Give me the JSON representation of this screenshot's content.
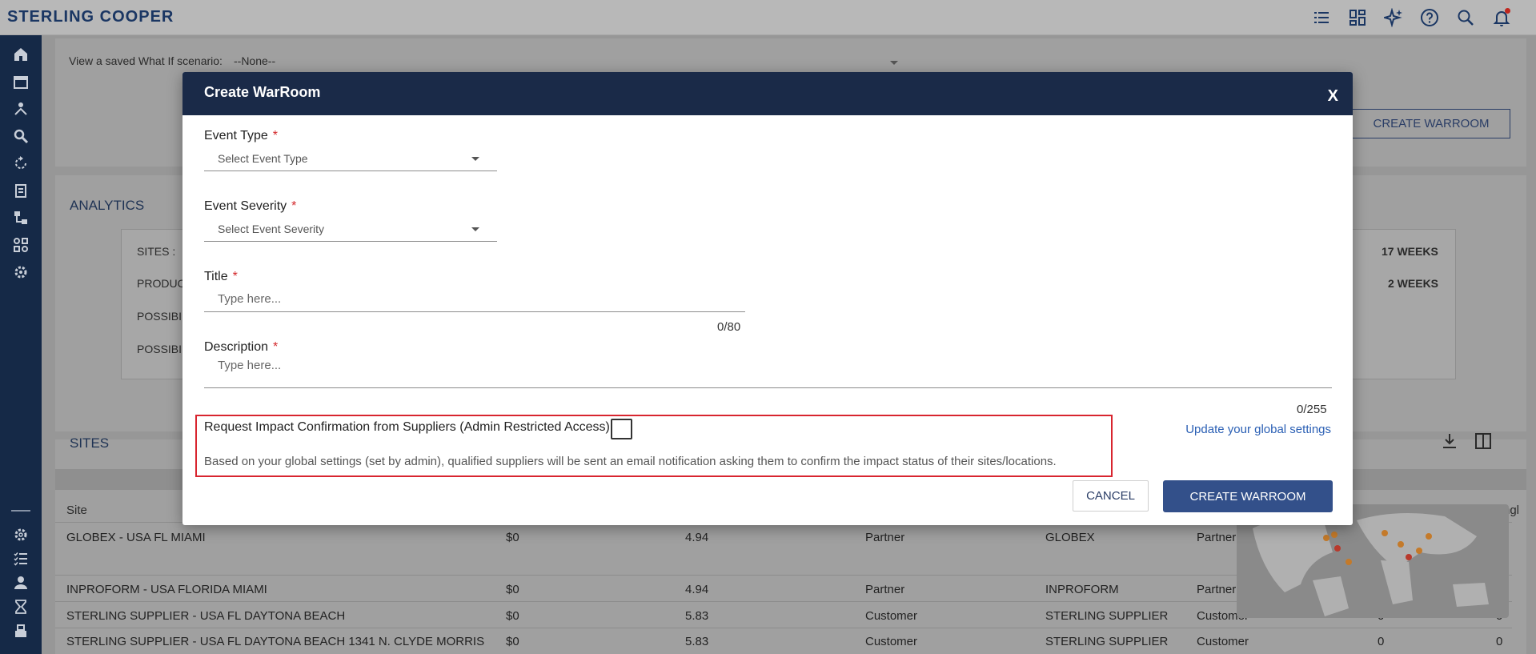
{
  "app": {
    "brand": "STERLING COOPER"
  },
  "topbar": {
    "icons": [
      "list-icon",
      "dashboard-icon",
      "sparkle-icon",
      "help-icon",
      "search-icon",
      "bell-icon"
    ]
  },
  "sidebar": {
    "items": [
      "home-icon",
      "calendar-icon",
      "network-icon",
      "search-icon",
      "refresh-icon",
      "clipboard-icon",
      "hierarchy-icon",
      "grid-icon",
      "settings-stack-icon"
    ],
    "bottom_items": [
      "gear-icon",
      "checklist-icon",
      "user-icon",
      "hourglass-icon",
      "layers-icon"
    ]
  },
  "background": {
    "scenario_label": "View a saved What If scenario:",
    "scenario_value": "--None--",
    "create_warroom_button": "CREATE WARROOM",
    "analytics": {
      "title": "ANALYTICS",
      "rows": [
        "SITES :",
        "PRODUC",
        "POSSIBI",
        "POSSIBI"
      ],
      "right_values": [
        "17 WEEKS",
        "2 WEEKS"
      ]
    },
    "sites": {
      "title": "SITES",
      "site_header": "Site",
      "partial_header": "ngl",
      "rows": [
        {
          "site": "GLOBEX - USA FL MIAMI",
          "value": "$0",
          "score": "4.94",
          "type": "Partner",
          "company": "GLOBEX",
          "rel": "Partner",
          "c1": "",
          "c2": ""
        },
        {
          "site": "INPROFORM - USA FLORIDA MIAMI",
          "value": "$0",
          "score": "4.94",
          "type": "Partner",
          "company": "INPROFORM",
          "rel": "Partner",
          "c1": "",
          "c2": ""
        },
        {
          "site": "STERLING SUPPLIER - USA FL DAYTONA BEACH",
          "value": "$0",
          "score": "5.83",
          "type": "Customer",
          "company": "STERLING SUPPLIER",
          "rel": "Customer",
          "c1": "0",
          "c2": "0"
        },
        {
          "site": "STERLING SUPPLIER - USA FL DAYTONA BEACH 1341 N. CLYDE MORRIS",
          "value": "$0",
          "score": "5.83",
          "type": "Customer",
          "company": "STERLING SUPPLIER",
          "rel": "Customer",
          "c1": "0",
          "c2": "0"
        }
      ]
    }
  },
  "modal": {
    "title": "Create WarRoom",
    "close": "X",
    "event_type": {
      "label": "Event Type",
      "placeholder": "Select Event Type"
    },
    "event_severity": {
      "label": "Event Severity",
      "placeholder": "Select Event Severity"
    },
    "title_field": {
      "label": "Title",
      "placeholder": "Type here...",
      "counter": "0/80"
    },
    "description": {
      "label": "Description",
      "placeholder": "Type here...",
      "counter": "0/255"
    },
    "required_mark": "*",
    "confirm": {
      "label": "Request Impact Confirmation from Suppliers (Admin Restricted Access)",
      "checked": false,
      "note": "Based on your global settings (set by admin), qualified suppliers will be sent an email notification asking them to confirm the impact status of their sites/locations."
    },
    "global_settings_link": "Update your global settings",
    "cancel_button": "CANCEL",
    "create_button": "CREATE WARROOM"
  }
}
